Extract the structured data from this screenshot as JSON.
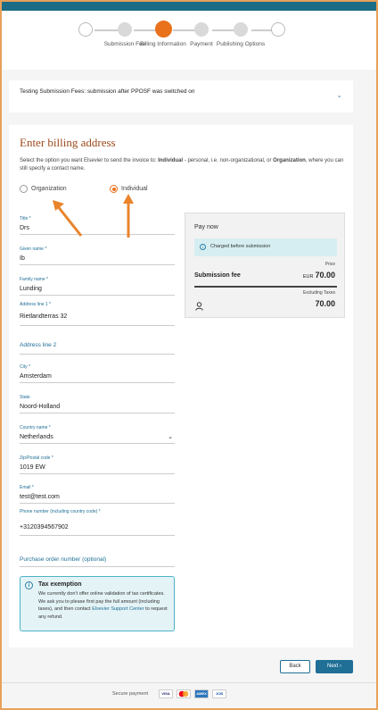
{
  "stepper": {
    "steps": [
      {
        "label": ""
      },
      {
        "label": "Submission Fee"
      },
      {
        "label": "Billing Information"
      },
      {
        "label": "Payment"
      },
      {
        "label": "Publishing Options"
      },
      {
        "label": ""
      }
    ]
  },
  "notice": {
    "text": "Testing Submission Fees: submission after PPOSF was switched on"
  },
  "billing": {
    "heading": "Enter billing address",
    "intro_1": "Select the option you want Elsevier to send the invoice to: ",
    "intro_individual": "Individual",
    "intro_2": " - personal, i.e. non-organizational, or ",
    "intro_organization": "Organization",
    "intro_3": ", where you can still specify a contact name.",
    "radio_organization": "Organization",
    "radio_individual": "Individual",
    "selected": "Individual"
  },
  "fields": {
    "title": {
      "label": "Title *",
      "value": "Drs"
    },
    "given_name": {
      "label": "Given name *",
      "value": "Ib"
    },
    "family_name": {
      "label": "Family name *",
      "value": "Lunding"
    },
    "address1": {
      "label": "Address line 1 *",
      "value": "Rietlandterras 32"
    },
    "address2": {
      "placeholder": "Address line 2"
    },
    "city": {
      "label": "City *",
      "value": "Amsterdam"
    },
    "state": {
      "label": "State",
      "value": "Noord-Holland"
    },
    "country": {
      "label": "Country name *",
      "value": "Netherlands"
    },
    "zip": {
      "label": "Zip/Postal code *",
      "value": "1019 EW"
    },
    "email": {
      "label": "Email *",
      "value": "test@test.com"
    },
    "phone": {
      "label": "Phone number (including country code) *",
      "value": "+3120394567902"
    },
    "po": {
      "placeholder": "Purchase order number (optional)"
    }
  },
  "tax": {
    "icon": "info-icon",
    "title": "Tax exemption",
    "body": "We currently don't offer online validation of tax certificates. We ask you to please first pay the full amount (including taxes), and then contact ",
    "link": "Elsevier Support Center",
    "body_end": " to request any refund."
  },
  "pay_now": {
    "title": "Pay now",
    "banner": "Charged before submission",
    "price_label": "Price",
    "fee_label": "Submission fee",
    "currency": "EUR",
    "fee_value": "70.00",
    "excl_label": "Excluding Taxes",
    "total_value": "70.00"
  },
  "actions": {
    "back": "Back",
    "next": "Next ›"
  },
  "footer": {
    "secure": "Secure payment",
    "cards": [
      "VISA",
      "MC",
      "AMEX",
      "JCB"
    ]
  },
  "colors": {
    "accent": "#e9711c",
    "link": "#1f6f96",
    "topbar": "#1c6c86",
    "heading": "#9c4a1d"
  }
}
